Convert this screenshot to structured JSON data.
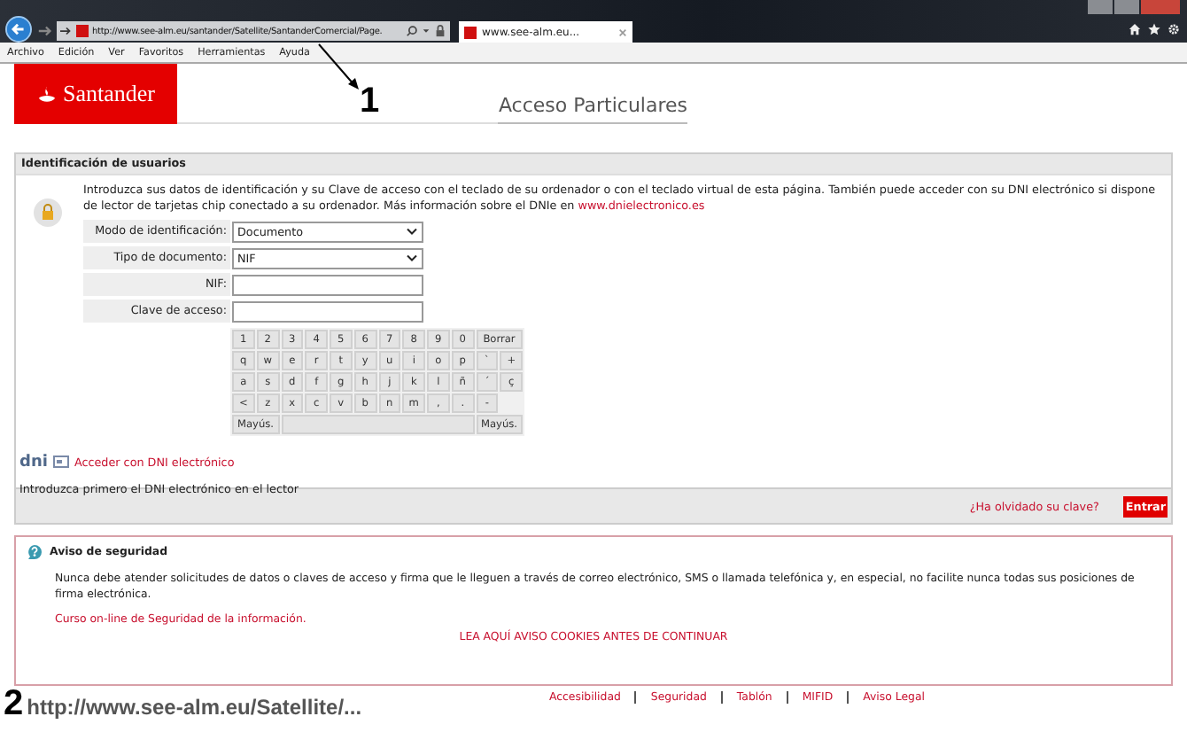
{
  "browser": {
    "address": "http://www.see-alm.eu/santander/Satellite/SantanderComercial/Page.",
    "tabs": [
      {
        "title": "www.see-alm.eu...",
        "selected": true
      }
    ],
    "menu": [
      "Archivo",
      "Edición",
      "Ver",
      "Favoritos",
      "Herramientas",
      "Ayuda"
    ]
  },
  "annotations": [
    {
      "label": "1"
    },
    {
      "label": "2",
      "text": "http://www.see-alm.eu/Satellite/..."
    }
  ],
  "header": {
    "logo": "Santander",
    "title": "Acceso Particulares"
  },
  "login": {
    "heading": "Identificación de usuarios",
    "intro": "Introduzca sus datos de identificación y su Clave de acceso con el teclado de su ordenador o con el teclado virtual de esta página. También puede acceder con su DNI electrónico si dispone de lector de tarjetas chip conectado a su ordenador. Más información sobre el DNIe en ",
    "intro_link": "www.dnielectronico.es",
    "fields": [
      {
        "label": "Modo de identificación:",
        "kind": "select",
        "value": "Documento"
      },
      {
        "label": "Tipo de documento:",
        "kind": "select",
        "value": "NIF"
      },
      {
        "label": "NIF:",
        "kind": "text"
      },
      {
        "label": "Clave de acceso:",
        "kind": "password"
      }
    ],
    "keyboard": [
      [
        {
          "label": "1",
          "kind": "key"
        },
        {
          "label": "2",
          "kind": "key"
        },
        {
          "label": "3",
          "kind": "key"
        },
        {
          "label": "4",
          "kind": "key"
        },
        {
          "label": "5",
          "kind": "key"
        },
        {
          "label": "6",
          "kind": "key"
        },
        {
          "label": "7",
          "kind": "key"
        },
        {
          "label": "8",
          "kind": "key"
        },
        {
          "label": "9",
          "kind": "key"
        },
        {
          "label": "0",
          "kind": "key"
        },
        {
          "label": "Borrar",
          "kind": "wide"
        }
      ],
      [
        {
          "label": "q",
          "kind": "key"
        },
        {
          "label": "w",
          "kind": "key"
        },
        {
          "label": "e",
          "kind": "key"
        },
        {
          "label": "r",
          "kind": "key"
        },
        {
          "label": "t",
          "kind": "key"
        },
        {
          "label": "y",
          "kind": "key"
        },
        {
          "label": "u",
          "kind": "key"
        },
        {
          "label": "i",
          "kind": "key"
        },
        {
          "label": "o",
          "kind": "key"
        },
        {
          "label": "p",
          "kind": "key"
        },
        {
          "label": "`",
          "kind": "key"
        },
        {
          "label": "+",
          "kind": "key"
        }
      ],
      [
        {
          "label": "a",
          "kind": "key"
        },
        {
          "label": "s",
          "kind": "key"
        },
        {
          "label": "d",
          "kind": "key"
        },
        {
          "label": "f",
          "kind": "key"
        },
        {
          "label": "g",
          "kind": "key"
        },
        {
          "label": "h",
          "kind": "key"
        },
        {
          "label": "j",
          "kind": "key"
        },
        {
          "label": "k",
          "kind": "key"
        },
        {
          "label": "l",
          "kind": "key"
        },
        {
          "label": "ñ",
          "kind": "key"
        },
        {
          "label": "´",
          "kind": "key"
        },
        {
          "label": "ç",
          "kind": "key"
        }
      ],
      [
        {
          "label": "<",
          "kind": "key"
        },
        {
          "label": "z",
          "kind": "key"
        },
        {
          "label": "x",
          "kind": "key"
        },
        {
          "label": "c",
          "kind": "key"
        },
        {
          "label": "v",
          "kind": "key"
        },
        {
          "label": "b",
          "kind": "key"
        },
        {
          "label": "n",
          "kind": "key"
        },
        {
          "label": "m",
          "kind": "key"
        },
        {
          "label": ",",
          "kind": "key"
        },
        {
          "label": ".",
          "kind": "key"
        },
        {
          "label": "-",
          "kind": "key"
        }
      ],
      [
        {
          "label": "Mayús.",
          "kind": "wide"
        },
        {
          "kind": "space"
        },
        {
          "label": "Mayús.",
          "kind": "wide"
        }
      ]
    ],
    "dni_logo": "dni",
    "dni_link": "Acceder con DNI electrónico",
    "dni_note": "Introduzca primero el DNI electrónico en el lector",
    "forgot": "¿Ha olvidado su clave?",
    "submit": "Entrar"
  },
  "security": {
    "heading": "Aviso de seguridad",
    "text": "Nunca debe atender solicitudes de datos o claves de acceso y firma que le lleguen a través de correo electrónico, SMS o llamada telefónica y, en especial, no facilite nunca todas sus posiciones de firma electrónica.",
    "course_link": "Curso on-line de Seguridad de la información.",
    "cookies_link": "LEA AQUÍ AVISO COOKIES ANTES DE CONTINUAR"
  },
  "footer_links": [
    "Accesibilidad",
    "Seguridad",
    "Tablón",
    "MIFID",
    "Aviso Legal"
  ]
}
